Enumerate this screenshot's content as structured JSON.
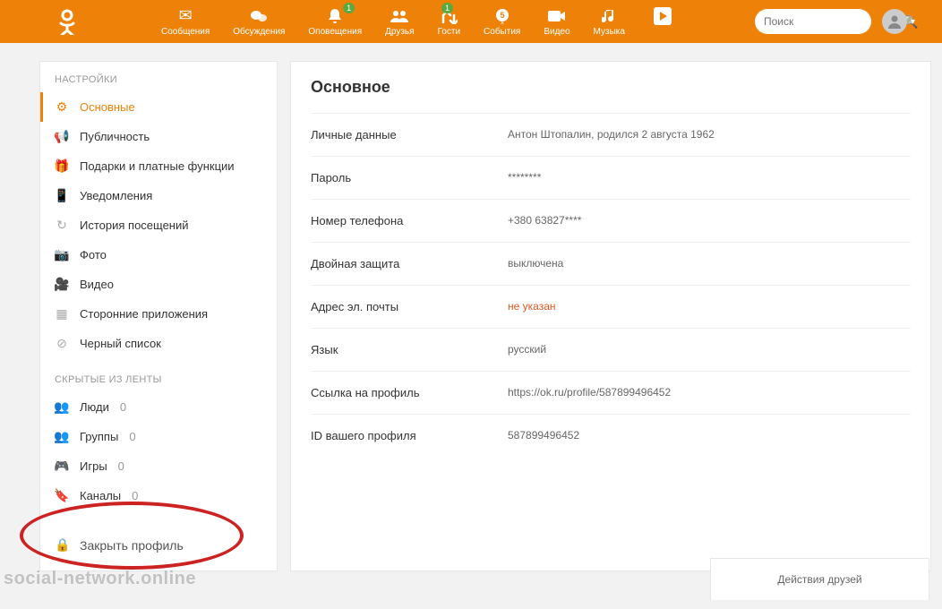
{
  "header": {
    "nav": [
      {
        "label": "Сообщения",
        "name": "messages",
        "badge": null
      },
      {
        "label": "Обсуждения",
        "name": "discussions",
        "badge": null
      },
      {
        "label": "Оповещения",
        "name": "notifications",
        "badge": "1"
      },
      {
        "label": "Друзья",
        "name": "friends",
        "badge": null
      },
      {
        "label": "Гости",
        "name": "guests",
        "badge": "1"
      },
      {
        "label": "События",
        "name": "events",
        "badge": null
      },
      {
        "label": "Видео",
        "name": "video",
        "badge": null
      },
      {
        "label": "Музыка",
        "name": "music",
        "badge": null
      }
    ],
    "search_placeholder": "Поиск"
  },
  "sidebar": {
    "title": "НАСТРОЙКИ",
    "items": [
      {
        "label": "Основные",
        "active": true
      },
      {
        "label": "Публичность"
      },
      {
        "label": "Подарки и платные функции"
      },
      {
        "label": "Уведомления"
      },
      {
        "label": "История посещений"
      },
      {
        "label": "Фото"
      },
      {
        "label": "Видео"
      },
      {
        "label": "Сторонние приложения"
      },
      {
        "label": "Черный список"
      }
    ],
    "hidden_title": "СКРЫТЫЕ ИЗ ЛЕНТЫ",
    "hidden_items": [
      {
        "label": "Люди",
        "count": "0"
      },
      {
        "label": "Группы",
        "count": "0"
      },
      {
        "label": "Игры",
        "count": "0"
      },
      {
        "label": "Каналы",
        "count": "0"
      }
    ],
    "close_profile": "Закрыть профиль"
  },
  "main": {
    "title": "Основное",
    "rows": [
      {
        "label": "Личные данные",
        "value": "Антон Штопалин, родился 2 августа 1962"
      },
      {
        "label": "Пароль",
        "value": "********"
      },
      {
        "label": "Номер телефона",
        "value": "+380 63827****"
      },
      {
        "label": "Двойная защита",
        "value": "выключена"
      },
      {
        "label": "Адрес эл. почты",
        "value": "не указан",
        "warn": true
      },
      {
        "label": "Язык",
        "value": "русский"
      },
      {
        "label": "Ссылка на профиль",
        "value": "https://ok.ru/profile/587899496452"
      },
      {
        "label": "ID вашего профиля",
        "value": "587899496452"
      }
    ]
  },
  "bottom_card": "Действия друзей",
  "watermark": "social-network.online"
}
